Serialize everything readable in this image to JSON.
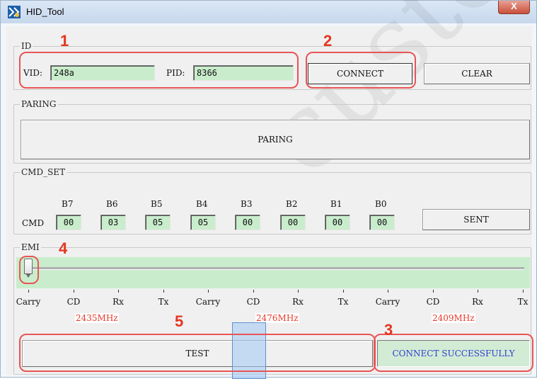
{
  "window": {
    "title": "HID_Tool",
    "close_glyph": "X"
  },
  "id_group": {
    "label": "ID",
    "vid_label": "VID:",
    "vid_value": "248a",
    "pid_label": "PID:",
    "pid_value": "8366",
    "connect_label": "CONNECT",
    "clear_label": "CLEAR"
  },
  "paring_group": {
    "label": "PARING",
    "button_label": "PARING"
  },
  "cmd_group": {
    "label": "CMD_SET",
    "row_label": "CMD",
    "bits": [
      {
        "name": "B7",
        "value": "00"
      },
      {
        "name": "B6",
        "value": "03"
      },
      {
        "name": "B5",
        "value": "05"
      },
      {
        "name": "B4",
        "value": "05"
      },
      {
        "name": "B3",
        "value": "00"
      },
      {
        "name": "B2",
        "value": "00"
      },
      {
        "name": "B1",
        "value": "00"
      },
      {
        "name": "B0",
        "value": "00"
      }
    ],
    "sent_label": "SENT"
  },
  "emi_group": {
    "label": "EMI",
    "slider_position": 0,
    "slider_steps": 12,
    "tick_labels": [
      "Carry",
      "CD",
      "Rx",
      "Tx",
      "Carry",
      "CD",
      "Rx",
      "Tx",
      "Carry",
      "CD",
      "Rx",
      "Tx"
    ],
    "frequencies": [
      "2435MHz",
      "2476MHz",
      "2409MHz"
    ],
    "test_label": "TEST",
    "status_text": "CONNECT SUCCESSFULLY"
  },
  "annotations": [
    "1",
    "2",
    "3",
    "4",
    "5"
  ],
  "colors": {
    "field_bg": "#c9edcc",
    "annotation_red": "#e53620",
    "status_text": "#2a3fd0",
    "freq_text": "#e53929"
  }
}
